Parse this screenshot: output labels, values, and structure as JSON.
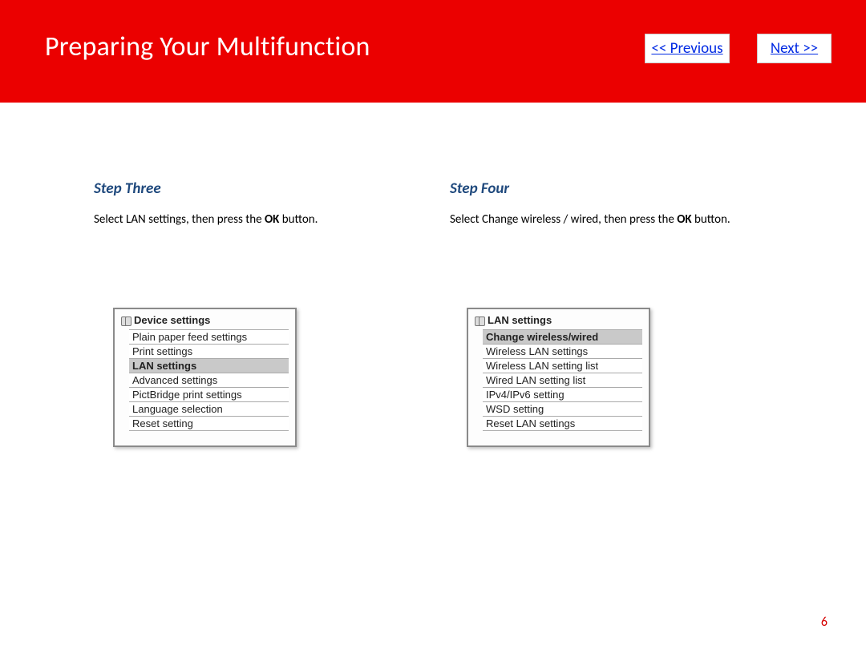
{
  "header": {
    "title": "Preparing Your Multifunction",
    "prev": "<< Previous",
    "next": "Next >>"
  },
  "steps": {
    "left": {
      "title": "Step Three",
      "desc_a": "Select LAN settings, then press the ",
      "desc_bold": "OK",
      "desc_b": " button.",
      "screen_title": "Device settings",
      "items": [
        {
          "label": "Plain paper feed settings",
          "selected": false
        },
        {
          "label": "Print settings",
          "selected": false
        },
        {
          "label": "LAN settings",
          "selected": true
        },
        {
          "label": "Advanced settings",
          "selected": false
        },
        {
          "label": "PictBridge print settings",
          "selected": false
        },
        {
          "label": "Language selection",
          "selected": false
        },
        {
          "label": "Reset setting",
          "selected": false
        }
      ]
    },
    "right": {
      "title": "Step Four",
      "desc_a": "Select Change wireless / wired, then press the ",
      "desc_bold": "OK",
      "desc_b": " button.",
      "screen_title": "LAN settings",
      "items": [
        {
          "label": "Change wireless/wired",
          "selected": true
        },
        {
          "label": "Wireless LAN settings",
          "selected": false
        },
        {
          "label": "Wireless LAN setting list",
          "selected": false
        },
        {
          "label": "Wired LAN setting list",
          "selected": false
        },
        {
          "label": "IPv4/IPv6 setting",
          "selected": false
        },
        {
          "label": "WSD setting",
          "selected": false
        },
        {
          "label": "Reset LAN settings",
          "selected": false
        }
      ]
    }
  },
  "page_number": "6"
}
